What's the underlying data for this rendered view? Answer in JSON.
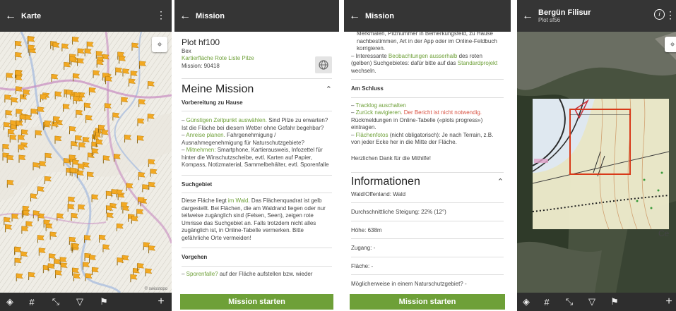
{
  "screen1": {
    "title": "Karte",
    "attribution": "© swisstopo"
  },
  "screen2": {
    "title": "Mission",
    "plot": "Plot hf100",
    "location": "Bex",
    "category_link": "Kartierfläche Rote Liste Pilze",
    "mission_id": "Mission: 90418",
    "heading": "Meine Mission",
    "prep_heading": "Vorbereitung zu Hause",
    "prep1_link": "Günstigen Zeitpunkt auswählen.",
    "prep1_text": " Sind Pilze zu erwarten? Ist die Fläche bei diesem Wetter ohne Gefahr begehbar?",
    "prep2_link": "Anreise planen.",
    "prep2_text": " Fahrgenehmigung / Ausnahmegenehmigung für Naturschutzgebiete?",
    "prep3_link": "Mitnehmen:",
    "prep3_text": " Smartphone, Kartierausweis, Infozettel für hinter die Winschutzscheibe, evtl. Karten auf Papier, Kompass, Notizmaterial, Sammelbehälter, evtl. Sporenfalle",
    "search_heading": "Suchgebiet",
    "search_text1": "Diese Fläche liegt ",
    "search_link": "im Wald",
    "search_text2": ". Das Flächenquadrat ist gelb dargestellt. Bei Flächen, die am Waldrand liegen oder nur teilweise zugänglich sind (Felsen, Seen), zeigen rote Umrisse das Suchgebiet an. Falls trotzdem nicht alles zugänglich ist, in Online-Tabelle vermerken. Bitte gefährliche Orte vermeiden!",
    "procedure_heading": "Vorgehen",
    "proc1_link": "Sporenfalle?",
    "proc1_text": " auf der Fläche aufstellen bzw. wieder",
    "button": "Mission starten"
  },
  "screen3": {
    "title": "Mission",
    "top_text": "Merkmalen, Pilznummer in Bemerkungsfeld, zu Hause nachbestimmen, Art in der App oder im Online-Feldbuch korrigieren.",
    "obs_text1": "– Interessante ",
    "obs_link": "Beobachtungen ausserhalb",
    "obs_text2": " des roten (gelben) Suchgebietes: dafür bitte auf das ",
    "obs_link2": "Standardprojekt",
    "obs_text3": " wechseln.",
    "end_heading": "Am Schluss",
    "end1_link": "Tracklog auschalten",
    "end2_link": "Zurück navigieren",
    "end2_red": ". Der Bericht ist nicht notwendig.",
    "end2_text": " Rückmeldungen in Online-Tabelle («plots progress») eintragen.",
    "end3_link": "Flächenfotos",
    "end3_text": " (nicht obligatorisch): Je nach Terrain, z.B. von jeder Ecke her in die Mitte der Fläche.",
    "thanks": "Herzlichen Dank für die Mithilfe!",
    "info_heading": "Informationen",
    "info1": "Wald/Offenland: Wald",
    "info2": "Durchschnittliche Steigung: 22% (12°)",
    "info3": "Höhe: 638m",
    "info4": "Zugang: -",
    "info5": "Fläche: -",
    "info6": "Möglicherweise in einem Naturschutzgebiet? -",
    "button": "Mission starten"
  },
  "screen4": {
    "title": "Bergün Filisur",
    "subtitle": "Plot sf56",
    "scale_label": "Ce"
  },
  "icons": {
    "back": "arrow-left-icon",
    "menu": "kebab-menu-icon",
    "location": "crosshair-icon",
    "layers": "layers-icon",
    "grid": "grid-icon",
    "collapse": "collapse-arrows-icon",
    "filter": "filter-icon",
    "flag": "flag-play-icon",
    "add": "plus-icon",
    "globe": "globe-icon",
    "info": "info-icon"
  },
  "colors": {
    "appbar": "#353535",
    "accent_green": "#6ea038",
    "flag_orange": "#f2a923",
    "warn_red": "#d85040"
  }
}
